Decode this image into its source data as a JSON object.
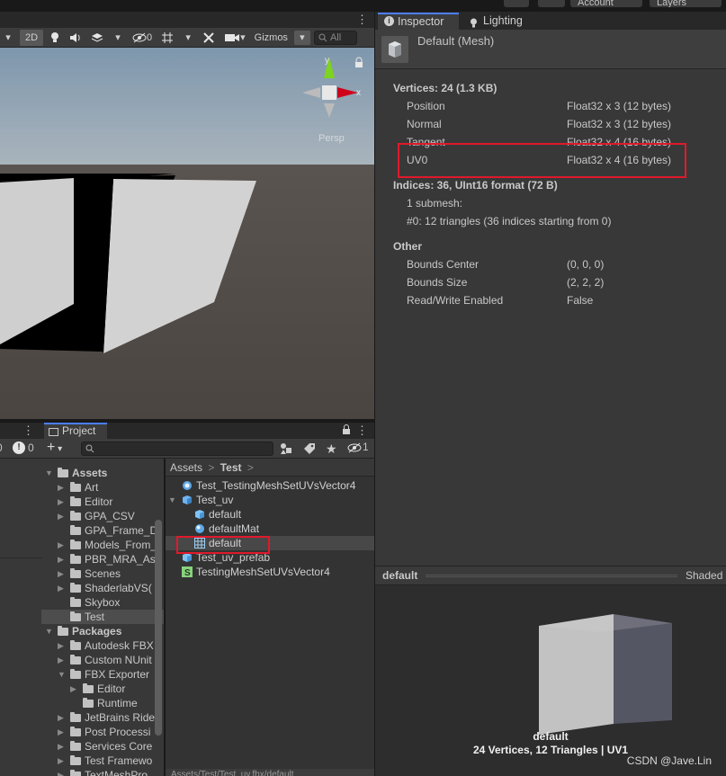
{
  "topbar": {
    "account_label": "Account",
    "layers_label": "Layers"
  },
  "scene": {
    "toolbar": {
      "mode_2d": "2D",
      "hidden_count": "0",
      "gizmos_label": "Gizmos",
      "search_placeholder": "All"
    },
    "gizmo": {
      "y_label": "y",
      "x_label": "x",
      "projection_label": "Persp"
    }
  },
  "hierarchy": {
    "error_count": "0",
    "count_left": "0"
  },
  "project": {
    "tab_label": "Project",
    "hidden_count": "1",
    "tree": [
      {
        "label": "Assets",
        "bold": true,
        "open": true
      },
      {
        "label": "Art"
      },
      {
        "label": "Editor"
      },
      {
        "label": "GPA_CSV"
      },
      {
        "label": "GPA_Frame_D"
      },
      {
        "label": "Models_From_"
      },
      {
        "label": "PBR_MRA_As"
      },
      {
        "label": "Scenes"
      },
      {
        "label": "ShaderlabVS("
      },
      {
        "label": "Skybox"
      },
      {
        "label": "Test",
        "selected": true
      },
      {
        "label": "Packages",
        "bold": true,
        "open": true
      },
      {
        "label": "Autodesk FBX"
      },
      {
        "label": "Custom NUnit"
      },
      {
        "label": "FBX Exporter",
        "open": true
      },
      {
        "label": "Editor"
      },
      {
        "label": "Runtime"
      },
      {
        "label": "JetBrains Ride"
      },
      {
        "label": "Post Processi"
      },
      {
        "label": "Services Core"
      },
      {
        "label": "Test Framewo"
      },
      {
        "label": "TextMeshPro"
      }
    ],
    "breadcrumb": {
      "root": "Assets",
      "current": "Test"
    },
    "files": [
      {
        "label": "Test_TestingMeshSetUVsVector4",
        "icon": "scene-icon"
      },
      {
        "label": "Test_uv",
        "icon": "model-prefab-icon"
      },
      {
        "label": "default",
        "icon": "prefab-icon"
      },
      {
        "label": "defaultMat",
        "icon": "material-icon"
      },
      {
        "label": "default",
        "icon": "mesh-grid-icon",
        "highlight": true
      },
      {
        "label": "Test_uv_prefab",
        "icon": "prefab-icon"
      },
      {
        "label": "TestingMeshSetUVsVector4",
        "icon": "script-icon"
      }
    ],
    "footer_path": "Assets/Test/Test_uv.fbx/default"
  },
  "inspector": {
    "tabs": {
      "inspector": "Inspector",
      "lighting": "Lighting"
    },
    "title": "Default (Mesh)",
    "vertices_header": "Vertices: 24 (1.3 KB)",
    "attributes": [
      {
        "name": "Position",
        "format": "Float32 x 3 (12 bytes)"
      },
      {
        "name": "Normal",
        "format": "Float32 x 3 (12 bytes)"
      },
      {
        "name": "Tangent",
        "format": "Float32 x 4 (16 bytes)"
      },
      {
        "name": "UV0",
        "format": "Float32 x 4 (16 bytes)"
      }
    ],
    "indices_header": "Indices: 36, UInt16 format (72 B)",
    "submesh_count": "1 submesh:",
    "submesh_detail": "#0: 12 triangles (36 indices starting from 0)",
    "other_header": "Other",
    "other": [
      {
        "name": "Bounds Center",
        "value": "(0, 0, 0)"
      },
      {
        "name": "Bounds Size",
        "value": "(2, 2, 2)"
      },
      {
        "name": "Read/Write Enabled",
        "value": "False"
      }
    ]
  },
  "preview": {
    "title": "default",
    "shading": "Shaded",
    "caption_name": "default",
    "caption_stats": "24 Vertices, 12 Triangles | UV1"
  },
  "watermark": "CSDN @Jave.Lin",
  "colors": {
    "accent": "#4c7eff",
    "highlight_box": "#e0192b"
  }
}
